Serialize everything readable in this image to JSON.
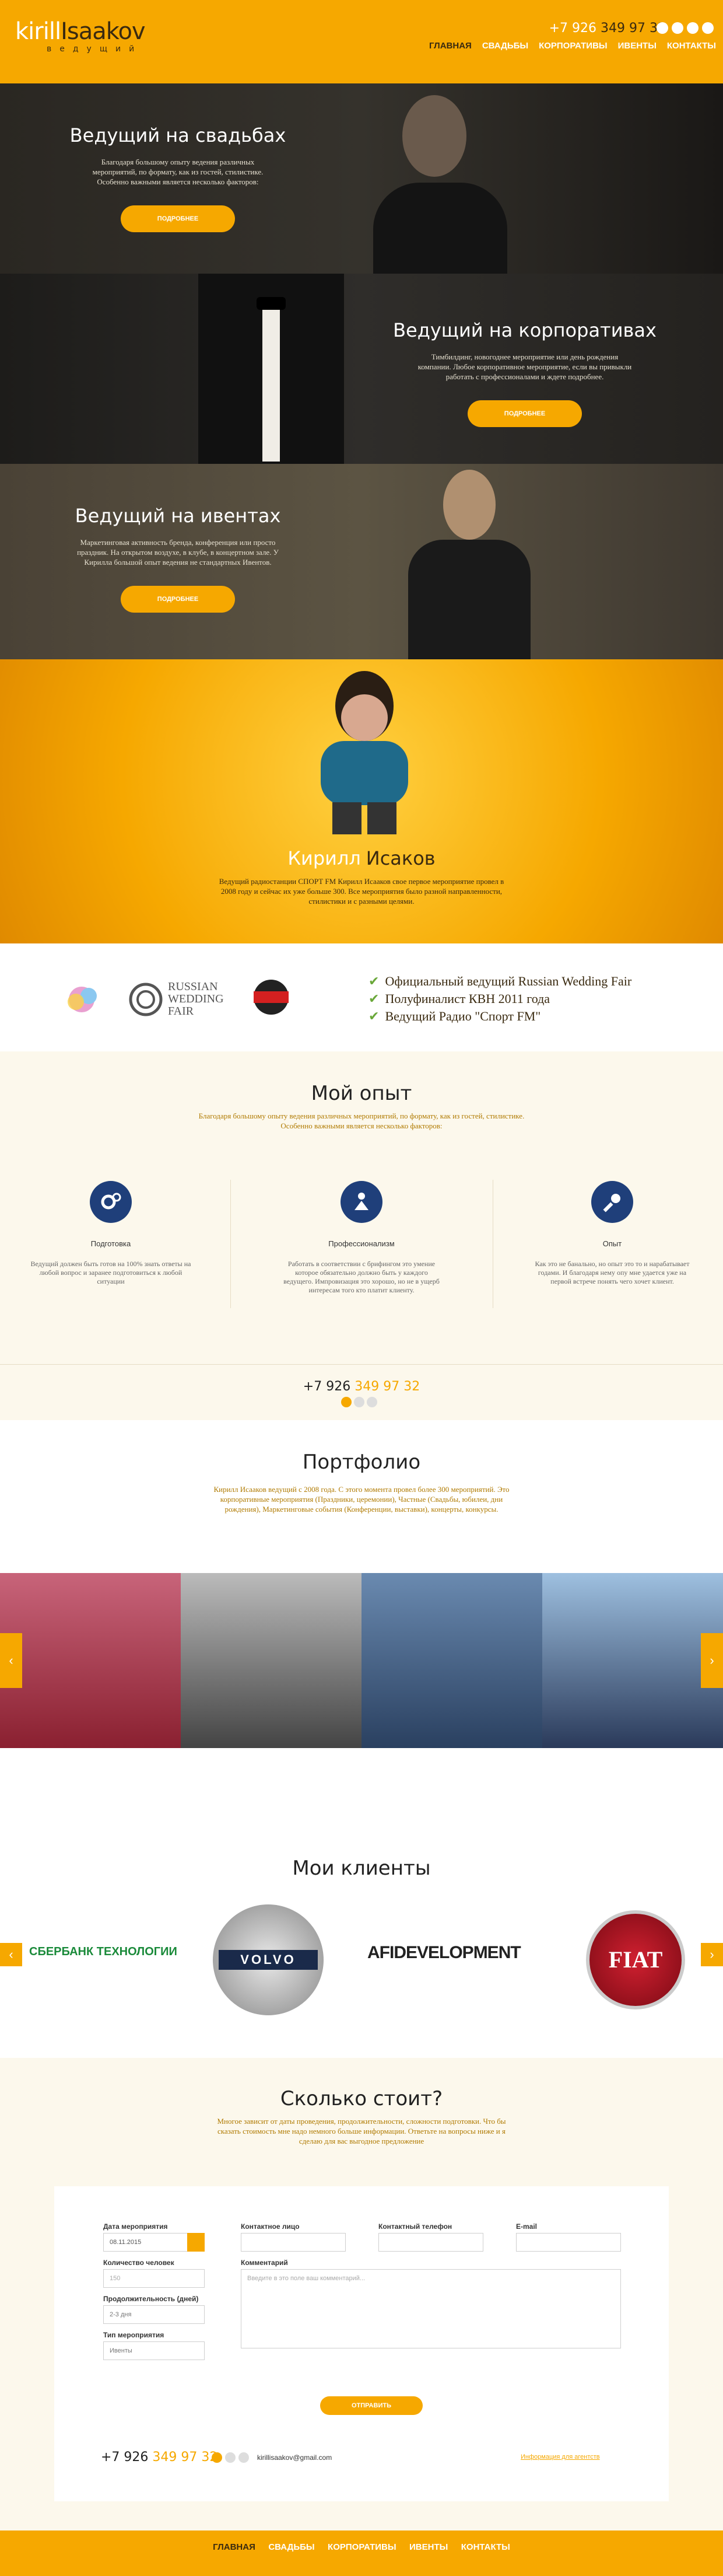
{
  "header": {
    "logo_first": "kirill",
    "logo_last": "Isaakov",
    "logo_sub": "ведущий",
    "phone_prefix": "+7 926",
    "phone_number": "349 97 32",
    "social": [
      "vk-icon",
      "twitter-icon",
      "facebook-icon",
      "instagram-icon"
    ],
    "nav": [
      "Главная",
      "Свадьбы",
      "Корпоративы",
      "Ивенты",
      "Контакты"
    ]
  },
  "hero_wedding": {
    "title": "Ведущий на свадьбах",
    "text": "Благодаря большому опыту ведения различных мероприятий, по формату, как из гостей, стилистике. Особенно важными является несколько факторов:",
    "button": "Подробнее"
  },
  "hero_corporate": {
    "title": "Ведущий на корпоративах",
    "text": "Тимбилдинг, новогоднее мероприятие или день рождения компании. Любое корпоративное мероприятие, если вы привыкли работать с профессионалами и ждете подробнее.",
    "button": "Подробнее"
  },
  "hero_events": {
    "title": "Ведущий на ивентах",
    "text": "Маркетинговая активность бренда, конференция или просто праздник. На открытом воздухе, в клубе, в концертном зале. У Кирилла большой опыт ведения не стандартных Ивентов.",
    "button": "Подробнее"
  },
  "about": {
    "name_first": "Кирилл",
    "name_last": "Исаков",
    "text": "Ведущий радиостанции СПОРТ FM Кирилл Исааков свое первое мероприятие провел в 2008 году и сейчас их уже больше 300. Все мероприятия было разной направленности, стилистики и с разными целями."
  },
  "badges": {
    "logos": [
      "rwf-logo",
      "russian-wedding-fair-logo",
      "sport-fm-logo"
    ],
    "rwf_text": [
      "RUSSIAN",
      "WEDDING",
      "FAIR"
    ],
    "achievements": [
      "Официальный ведущий Russian Wedding Fair",
      "Полуфиналист КВН 2011 года",
      "Ведущий Радио \"Спорт FM\""
    ]
  },
  "experience": {
    "title": "Мой опыт",
    "intro": "Благодаря большому опыту ведения различных мероприятий, по формату, как из гостей, стилистике. Особенно важными является несколько факторов:",
    "columns": [
      {
        "icon": "gears-icon",
        "title": "Подготовка",
        "text": "Ведущий должен быть готов на 100% знать ответы на любой вопрос и заранее подготовиться к любой ситуации"
      },
      {
        "icon": "presenter-icon",
        "title": "Профессионализм",
        "text": "Работать в соответствии с брифингом это умение которое обязательно должно быть у каждого ведущего. Импровизация это хорошо, но не в ущерб интересам того кто платит клиенту."
      },
      {
        "icon": "microphone-icon",
        "title": "Опыт",
        "text": "Как это не банально, но опыт это то и нарабатывает годами. И благодаря нему опу мне удается уже на первой встрече понять чего хочет клиент."
      }
    ],
    "phone_prefix": "+7 926",
    "phone_number": "349 97 32"
  },
  "portfolio": {
    "title": "Портфолио",
    "intro": "Кирилл Исааков ведущий с 2008 года. С этого момента провел более 300 мероприятий. Это корпоративные мероприятия (Праздники, церемонии), Частные (Свадьбы, юбилеи, дни рождения), Маркетинговые события (Конференции, выставки), концерты, конкурсы."
  },
  "clients": {
    "title": "Мои клиенты",
    "logos": [
      "СБЕРБАНК ТЕХНОЛОГИИ",
      "VOLVO",
      "AFIDEVELOPMENT",
      "FIAT"
    ]
  },
  "cost": {
    "title": "Сколько стоит?",
    "intro": "Многое зависит от даты проведения, продолжительности, сложности подготовки. Что бы сказать стоимость мне надо немного больше информации. Ответьте на вопросы ниже и я сделаю для вас выгодное предложение",
    "form": {
      "date_label": "Дата мероприятия",
      "date_value": "08.11.2015",
      "guests_label": "Количество человек",
      "guests_placeholder": "150",
      "duration_label": "Продолжительность (дней)",
      "duration_value": "2-3 дня",
      "type_label": "Тип мероприятия",
      "type_value": "Ивенты",
      "contact_label": "Контактное лицо",
      "phone_label": "Контактный телефон",
      "email_label": "E-mail",
      "comment_label": "Комментарий",
      "comment_placeholder": "Введите в это поле ваш комментарий...",
      "submit": "Отправить"
    },
    "phone_prefix": "+7 926",
    "phone_number": "349 97 32",
    "email": "kirillisaakov@gmail.com",
    "privacy": "Информация для агентств"
  },
  "footer": {
    "nav": [
      "Главная",
      "Свадьбы",
      "Корпоративы",
      "Ивенты",
      "Контакты"
    ]
  },
  "colors": {
    "accent": "#f6a800",
    "dark": "#3a2a10",
    "navy": "#1f3f7a"
  }
}
